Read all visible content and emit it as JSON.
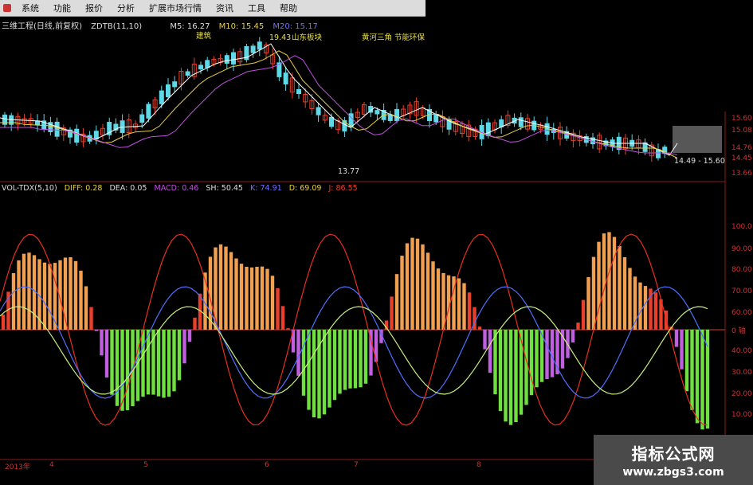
{
  "menu": [
    "系统",
    "功能",
    "报价",
    "分析",
    "扩展市场行情",
    "资讯",
    "工具",
    "帮助"
  ],
  "upper": {
    "title": "三维工程(日线,前复权)",
    "indicator": "ZDTB(11,10)",
    "ma5_label": "M5: 16.27",
    "ma10_label": "M10: 15.45",
    "ma_extra_label": "M20: 15.17",
    "annotations": {
      "high": "19.43",
      "low": "13.77",
      "range_box": "14.49 - 15.60",
      "tag1": "建筑",
      "tag2": "山东板块",
      "tag3": "黄河三角 节能环保"
    },
    "price_ticks": [
      "15.60",
      "15.08",
      "14.76",
      "14.45",
      "13.66"
    ]
  },
  "lower": {
    "indicator_name": "VOL-TDX(5,10)",
    "values": [
      "DIFF: 0.28",
      "DEA: 0.05",
      "MACD: 0.46",
      "SH: 50.45",
      "K: 74.91",
      "D: 69.09",
      "J: 86.55"
    ],
    "y_ticks": [
      "100.0",
      "90.00",
      "80.00",
      "70.00",
      "60.00",
      "0 轴",
      "40.00",
      "30.00",
      "20.00",
      "10.00"
    ]
  },
  "dates": [
    "2013年",
    "4",
    "5",
    "6",
    "7",
    "8"
  ],
  "watermark": {
    "title": "指标公式网",
    "url": "www.zbgs3.com"
  },
  "colors": {
    "up": "#e8402a",
    "down": "#5fd8e8",
    "ma5": "#ffffff",
    "ma10": "#e8d040",
    "ma20": "#c050e0",
    "macd_up_red": "#e8402a",
    "macd_up_orange": "#f0a050",
    "macd_down_green": "#70e040",
    "macd_down_purple": "#c060e0"
  }
}
